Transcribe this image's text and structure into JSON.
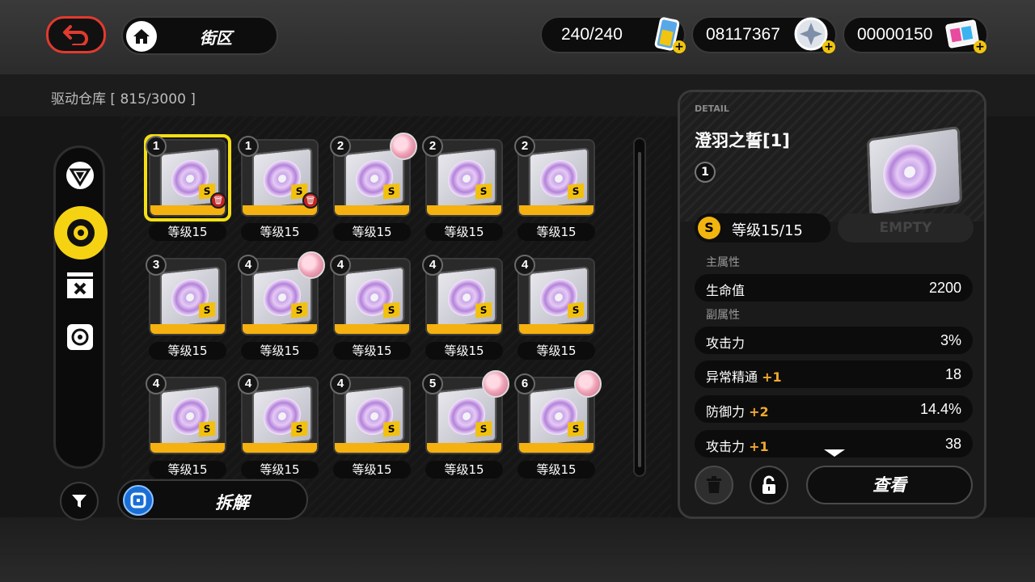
{
  "topbar": {
    "home_label": "街区",
    "battery": "240/240",
    "denny": "08117367",
    "film": "00000150"
  },
  "inventory": {
    "title": "驱动仓库 [ 815/3000 ]",
    "dismantle_label": "拆解",
    "items": [
      {
        "slot": "1",
        "level": "等级15",
        "selected": true,
        "trash": true,
        "equipped": false
      },
      {
        "slot": "1",
        "level": "等级15",
        "selected": false,
        "trash": true,
        "equipped": false
      },
      {
        "slot": "2",
        "level": "等级15",
        "selected": false,
        "trash": false,
        "equipped": true
      },
      {
        "slot": "2",
        "level": "等级15",
        "selected": false,
        "trash": false,
        "equipped": false
      },
      {
        "slot": "2",
        "level": "等级15",
        "selected": false,
        "trash": false,
        "equipped": false
      },
      {
        "slot": "3",
        "level": "等级15",
        "selected": false,
        "trash": false,
        "equipped": false
      },
      {
        "slot": "4",
        "level": "等级15",
        "selected": false,
        "trash": false,
        "equipped": true
      },
      {
        "slot": "4",
        "level": "等级15",
        "selected": false,
        "trash": false,
        "equipped": false
      },
      {
        "slot": "4",
        "level": "等级15",
        "selected": false,
        "trash": false,
        "equipped": false
      },
      {
        "slot": "4",
        "level": "等级15",
        "selected": false,
        "trash": false,
        "equipped": false
      },
      {
        "slot": "4",
        "level": "等级15",
        "selected": false,
        "trash": false,
        "equipped": false
      },
      {
        "slot": "4",
        "level": "等级15",
        "selected": false,
        "trash": false,
        "equipped": false
      },
      {
        "slot": "4",
        "level": "等级15",
        "selected": false,
        "trash": false,
        "equipped": false
      },
      {
        "slot": "5",
        "level": "等级15",
        "selected": false,
        "trash": false,
        "equipped": true
      },
      {
        "slot": "6",
        "level": "等级15",
        "selected": false,
        "trash": false,
        "equipped": true
      }
    ]
  },
  "detail": {
    "caption": "DETAIL",
    "name": "澄羽之誓[1]",
    "slot": "1",
    "level": "等级15/15",
    "empty_label": "EMPTY",
    "main_stat_title": "主属性",
    "main_stat": {
      "name": "生命值",
      "value": "2200"
    },
    "sub_stat_title": "副属性",
    "sub_stats": [
      {
        "name": "攻击力",
        "bonus": "",
        "value": "3%"
      },
      {
        "name": "异常精通",
        "bonus": "+1",
        "value": "18"
      },
      {
        "name": "防御力",
        "bonus": "+2",
        "value": "14.4%"
      },
      {
        "name": "攻击力",
        "bonus": "+1",
        "value": "38"
      }
    ],
    "view_label": "查看"
  },
  "colors": {
    "accent_yellow": "#f5d313",
    "rarity_bar": "#f5b10f",
    "back_red": "#e23a2f",
    "bonus_orange": "#f2a830"
  }
}
